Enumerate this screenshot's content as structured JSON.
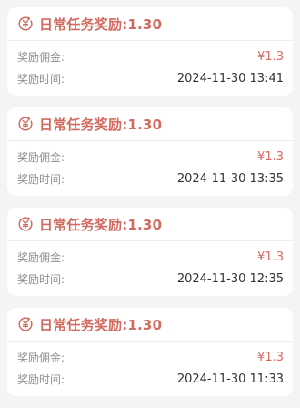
{
  "colors": {
    "accent": "#D36A5F",
    "page_background": "#F4F4F6",
    "card_background": "#FFFFFF"
  },
  "records": [
    {
      "title": "日常任务奖励:1.30",
      "commission_label": "奖励佣金:",
      "commission_value": "¥1.3",
      "time_label": "奖励时间:",
      "time_value": "2024-11-30 13:41",
      "icon": "yuan-circle-icon"
    },
    {
      "title": "日常任务奖励:1.30",
      "commission_label": "奖励佣金:",
      "commission_value": "¥1.3",
      "time_label": "奖励时间:",
      "time_value": "2024-11-30 13:35",
      "icon": "yuan-circle-icon"
    },
    {
      "title": "日常任务奖励:1.30",
      "commission_label": "奖励佣金:",
      "commission_value": "¥1.3",
      "time_label": "奖励时间:",
      "time_value": "2024-11-30 12:35",
      "icon": "yuan-circle-icon"
    },
    {
      "title": "日常任务奖励:1.30",
      "commission_label": "奖励佣金:",
      "commission_value": "¥1.3",
      "time_label": "奖励时间:",
      "time_value": "2024-11-30 11:33",
      "icon": "yuan-circle-icon"
    }
  ]
}
